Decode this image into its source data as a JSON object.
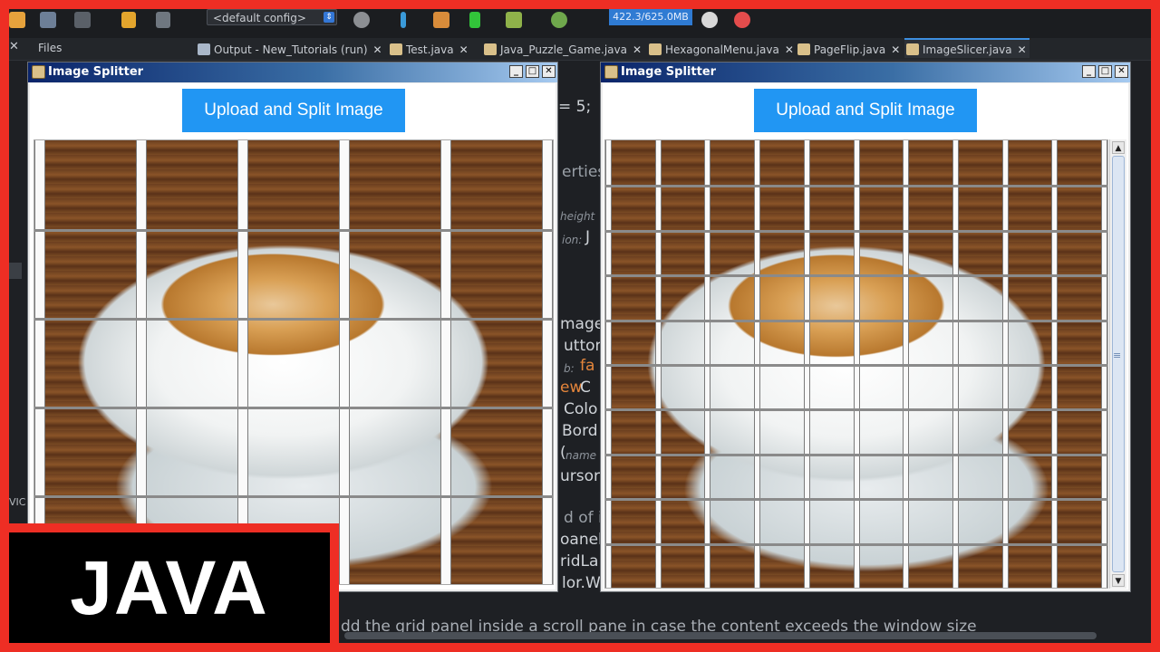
{
  "ide": {
    "config_label": "<default config>",
    "config_arrow": "⇕",
    "memory": "422.3/625.0MB",
    "files_label": "Files",
    "tabs": [
      {
        "label": "Output - New_Tutorials (run)",
        "close": "✕"
      },
      {
        "label": "Test.java",
        "close": "✕"
      },
      {
        "label": "Java_Puzzle_Game.java",
        "close": "✕"
      },
      {
        "label": "HexagonalMenu.java",
        "close": "✕"
      },
      {
        "label": "PageFlip.java",
        "close": "✕"
      },
      {
        "label": "ImageSlicer.java",
        "close": "✕"
      }
    ],
    "code_fragments": {
      "l1": "= 5;",
      "l2": "erties",
      "l3": "height",
      "l4": "ion:",
      "l4b": "J",
      "l5": "mage",
      "l6": "utton",
      "l7": "b:",
      "l7b": "fa",
      "l8a": "ew",
      "l8b": " C",
      "l9": "Colo",
      "l10": "Bord",
      "l11a": "(",
      "l11b": "name",
      "l12": "ursor",
      "l13": "d of i",
      "l14": "oanel",
      "l15": "ridLa",
      "l16": "lor.W",
      "left_edge": "VIC",
      "bottom": "dd the grid panel inside a scroll pane in case the content exceeds the window size"
    }
  },
  "windows": [
    {
      "title": "Image Splitter",
      "button_label": "Upload and Split Image",
      "grid": {
        "cols": 5,
        "rows": 5
      }
    },
    {
      "title": "Image Splitter",
      "button_label": "Upload and Split Image",
      "grid": {
        "cols": 10,
        "rows": 10
      }
    }
  ],
  "window_controls": {
    "minimize": "_",
    "maximize": "□",
    "close": "✕"
  },
  "scroll": {
    "up": "▲",
    "down": "▼",
    "grip": "≡"
  },
  "badge": "JAVA",
  "colors": {
    "accent_button": "#2196f3",
    "frame_red": "#ee2e24",
    "badge_bg": "#000000"
  }
}
